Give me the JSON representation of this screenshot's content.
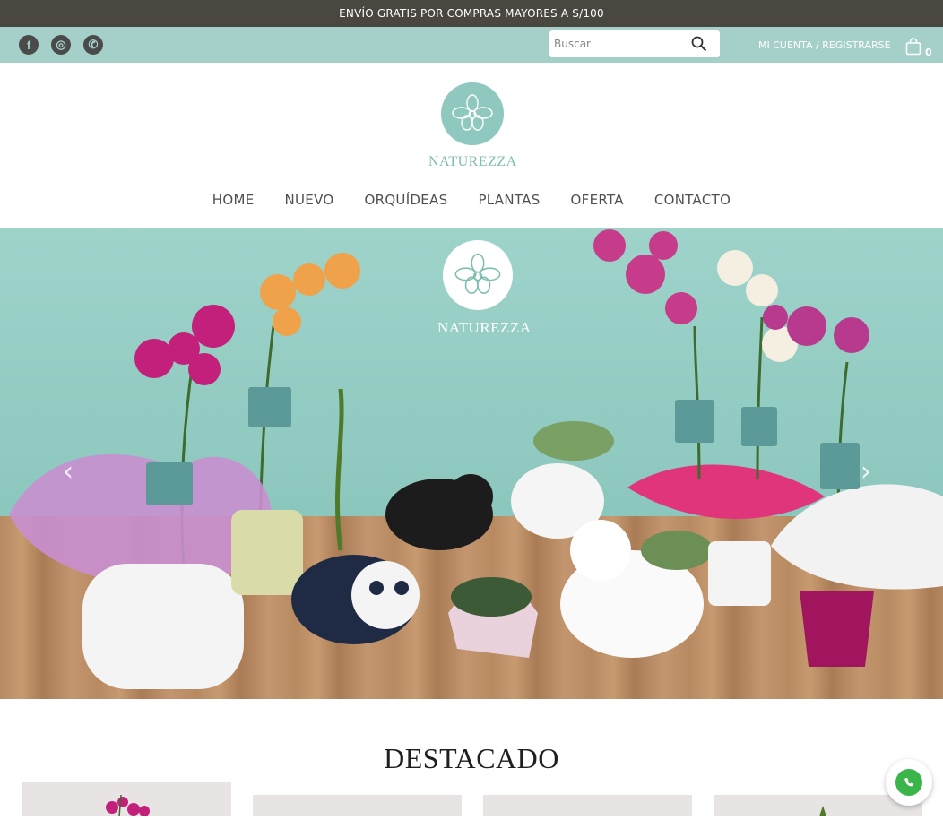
{
  "promo": {
    "text": "ENVÍO GRATIS POR COMPRAS MAYORES A S/100"
  },
  "social": [
    {
      "icon": "facebook-icon",
      "glyph": "f"
    },
    {
      "icon": "instagram-icon",
      "glyph": "◎"
    },
    {
      "icon": "whatsapp-icon",
      "glyph": "✆"
    }
  ],
  "search": {
    "placeholder": "Buscar",
    "value": ""
  },
  "account": {
    "label": "MI CUENTA / REGISTRARSE"
  },
  "cart": {
    "count": "0"
  },
  "logo": {
    "text": "NATUREZZA"
  },
  "nav": [
    {
      "label": "HOME"
    },
    {
      "label": "NUEVO"
    },
    {
      "label": "ORQUÍDEAS"
    },
    {
      "label": "PLANTAS"
    },
    {
      "label": "OFERTA"
    },
    {
      "label": "CONTACTO"
    }
  ],
  "hero": {
    "brand": "NATUREZZA",
    "tag_text": "NATUREZZA",
    "prev_glyph": "‹",
    "next_glyph": "›"
  },
  "featured": {
    "title": "DESTACADO"
  },
  "colors": {
    "promo_bg": "#4a4640",
    "topbar_bg": "#a4d0c9",
    "hero_bg": "#9ed3ca",
    "accent": "#8fc8be",
    "whatsapp": "#3ab54a"
  }
}
